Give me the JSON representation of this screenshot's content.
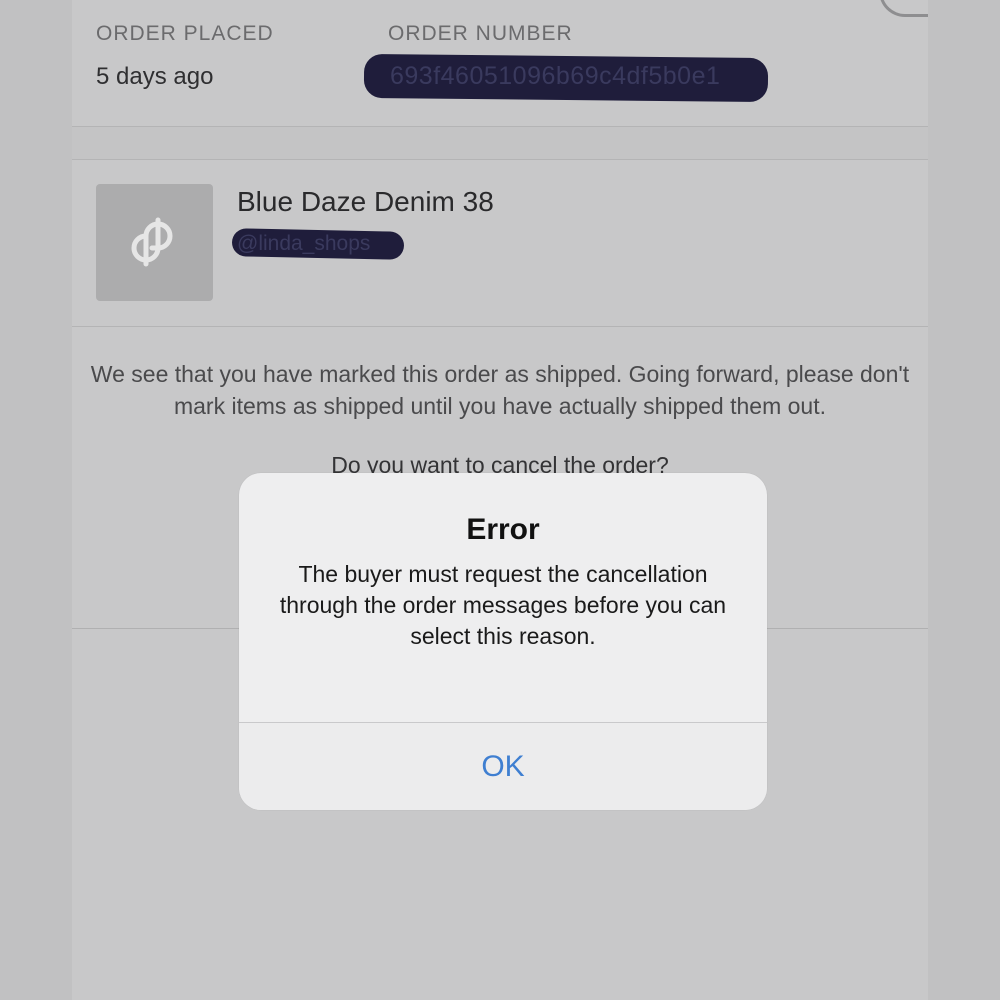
{
  "order": {
    "placed_label": "ORDER PLACED",
    "placed_value": "5 days ago",
    "number_label": "ORDER NUMBER",
    "number_value": "693f46051096b69c4df5b0e1"
  },
  "item": {
    "title": "Blue Daze Denim 38",
    "seller": "@linda_shops",
    "thumbnail_icon": "poshmark-logo-icon"
  },
  "notice": {
    "text": "We see that you have marked this order as shipped. Going forward, please don't mark items as shipped until you have actually shipped them out.",
    "question": "Do you want to cancel the order?"
  },
  "alert": {
    "title": "Error",
    "message": "The buyer must request the cancellation through the order messages before you can select this reason.",
    "ok_label": "OK"
  },
  "colors": {
    "accent": "#3f7fd1",
    "redaction": "#1f1d3b"
  }
}
